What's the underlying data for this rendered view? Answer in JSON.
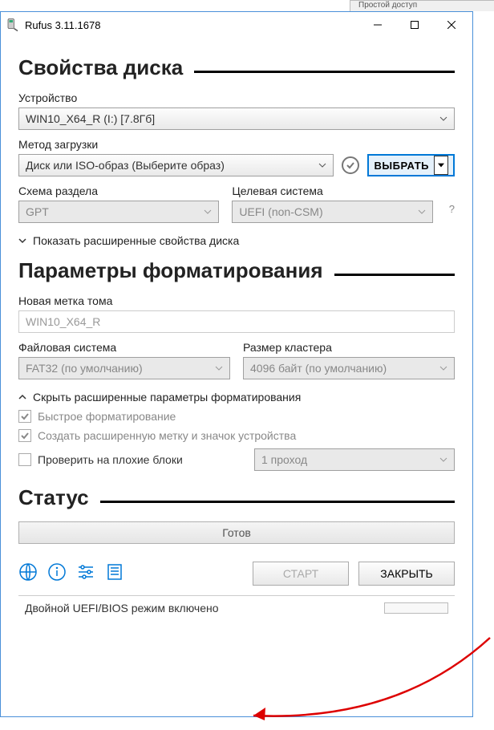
{
  "fragment_top": "Простой доступ",
  "title": "Rufus 3.11.1678",
  "sections": {
    "drive": "Свойства диска",
    "format": "Параметры форматирования",
    "status": "Статус"
  },
  "labels": {
    "device": "Устройство",
    "boot": "Метод загрузки",
    "scheme": "Схема раздела",
    "target": "Целевая система",
    "volume": "Новая метка тома",
    "fs": "Файловая система",
    "cluster": "Размер кластера"
  },
  "values": {
    "device": "WIN10_X64_R (I:) [7.8Гб]",
    "boot": "Диск или ISO-образ (Выберите образ)",
    "select_btn": "ВЫБРАТЬ",
    "scheme": "GPT",
    "target": "UEFI (non-CSM)",
    "help": "?",
    "show_adv_drive": "Показать расширенные свойства диска",
    "volume": "WIN10_X64_R",
    "fs": "FAT32 (по умолчанию)",
    "cluster": "4096 байт (по умолчанию)",
    "hide_adv_fmt": "Скрыть расширенные параметры форматирования",
    "quick": "Быстрое форматирование",
    "extlabel": "Создать расширенную метку и значок устройства",
    "badblocks": "Проверить на плохие блоки",
    "passes": "1 проход",
    "ready": "Готов",
    "start": "СТАРТ",
    "close": "ЗАКРЫТЬ",
    "statusline": "Двойной UEFI/BIOS режим включено"
  },
  "colors": {
    "accent": "#0078d7"
  }
}
